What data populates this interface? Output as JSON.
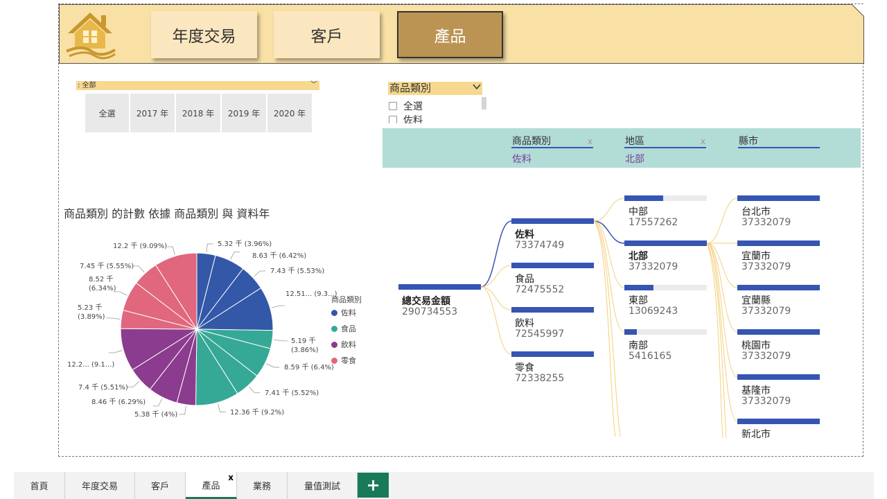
{
  "nav": {
    "buttons": [
      {
        "label": "年度交易",
        "active": false
      },
      {
        "label": "客戶",
        "active": false
      },
      {
        "label": "產品",
        "active": true
      }
    ]
  },
  "year_slicer": {
    "selected": ": 全部",
    "tiles": [
      "全選",
      "2017 年",
      "2018 年",
      "2019 年",
      "2020 年"
    ]
  },
  "category_slicer": {
    "title": "商品類別",
    "options": [
      "全選",
      "佐料"
    ]
  },
  "filters": [
    {
      "label": "商品類別",
      "value": "佐料"
    },
    {
      "label": "地區",
      "value": "北部"
    },
    {
      "label": "縣市",
      "value": ""
    }
  ],
  "pie": {
    "title": "商品類別 的計數 依據 商品類別 與 資料年",
    "legend_title": "商品類別",
    "legend": [
      {
        "name": "佐料",
        "color": "#3358a8"
      },
      {
        "name": "食品",
        "color": "#36a896"
      },
      {
        "name": "飲料",
        "color": "#8b3c8e"
      },
      {
        "name": "零食",
        "color": "#e0677e"
      }
    ],
    "slice_labels": [
      "5.32 千 (3.96%)",
      "8.63 千 (6.42%)",
      "7.43 千 (5.53%)",
      "12.51... (9.3...)",
      "5.19 千\n(3.86%)",
      "8.59 千 (6.4%)",
      "7.41 千 (5.52%)",
      "12.36 千 (9.2%)",
      "5.38 千 (4%)",
      "8.46 千 (6.29%)",
      "7.4 千 (5.51%)",
      "12.2... (9.1...)",
      "5.23 千\n(3.89%)",
      "8.52 千\n(6.34%)",
      "7.45 千 (5.55%)",
      "12.2 千 (9.09%)"
    ]
  },
  "chart_data": {
    "type": "pie",
    "title": "商品類別 的計數 依據 商品類別 與 資料年",
    "unit": "千",
    "slices": [
      {
        "category": "佐料",
        "value": 5.32,
        "percent": 3.96
      },
      {
        "category": "佐料",
        "value": 8.63,
        "percent": 6.42
      },
      {
        "category": "佐料",
        "value": 7.43,
        "percent": 5.53
      },
      {
        "category": "佐料",
        "value": 12.51,
        "percent": 9.3
      },
      {
        "category": "食品",
        "value": 5.19,
        "percent": 3.86
      },
      {
        "category": "食品",
        "value": 8.59,
        "percent": 6.4
      },
      {
        "category": "食品",
        "value": 7.41,
        "percent": 5.52
      },
      {
        "category": "食品",
        "value": 12.36,
        "percent": 9.2
      },
      {
        "category": "飲料",
        "value": 5.38,
        "percent": 4
      },
      {
        "category": "飲料",
        "value": 8.46,
        "percent": 6.29
      },
      {
        "category": "飲料",
        "value": 7.4,
        "percent": 5.51
      },
      {
        "category": "飲料",
        "value": 12.2,
        "percent": 9.1
      },
      {
        "category": "零食",
        "value": 5.23,
        "percent": 3.89
      },
      {
        "category": "零食",
        "value": 8.52,
        "percent": 6.34
      },
      {
        "category": "零食",
        "value": 7.45,
        "percent": 5.55
      },
      {
        "category": "零食",
        "value": 12.2,
        "percent": 9.09
      }
    ],
    "legend_position": "right"
  },
  "tree": {
    "root": {
      "name": "總交易金額",
      "value": "290734553"
    },
    "level1": [
      {
        "name": "佐料",
        "value": "73374749",
        "fill": 1.0,
        "selected": true
      },
      {
        "name": "食品",
        "value": "72475552",
        "fill": 1.0
      },
      {
        "name": "飲料",
        "value": "72545997",
        "fill": 1.0
      },
      {
        "name": "零食",
        "value": "72338255",
        "fill": 1.0
      }
    ],
    "level2": [
      {
        "name": "中部",
        "value": "17557262",
        "fill": 0.47
      },
      {
        "name": "北部",
        "value": "37332079",
        "fill": 1.0,
        "selected": true
      },
      {
        "name": "東部",
        "value": "13069243",
        "fill": 0.35
      },
      {
        "name": "南部",
        "value": "5416165",
        "fill": 0.15
      }
    ],
    "level3": [
      {
        "name": "台北市",
        "value": "37332079",
        "fill": 1.0
      },
      {
        "name": "宜蘭市",
        "value": "37332079",
        "fill": 1.0
      },
      {
        "name": "宜蘭縣",
        "value": "37332079",
        "fill": 1.0
      },
      {
        "name": "桃園市",
        "value": "37332079",
        "fill": 1.0
      },
      {
        "name": "基隆市",
        "value": "37332079",
        "fill": 1.0
      },
      {
        "name": "新北市",
        "value": "",
        "fill": 1.0
      }
    ]
  },
  "tabs": [
    {
      "label": "首頁"
    },
    {
      "label": "年度交易"
    },
    {
      "label": "客戶"
    },
    {
      "label": "產品",
      "active": true
    },
    {
      "label": "業務"
    },
    {
      "label": "量值測試"
    }
  ],
  "add_tab_label": "+",
  "close_glyph": "x",
  "dropdown_glyph": "﹀"
}
